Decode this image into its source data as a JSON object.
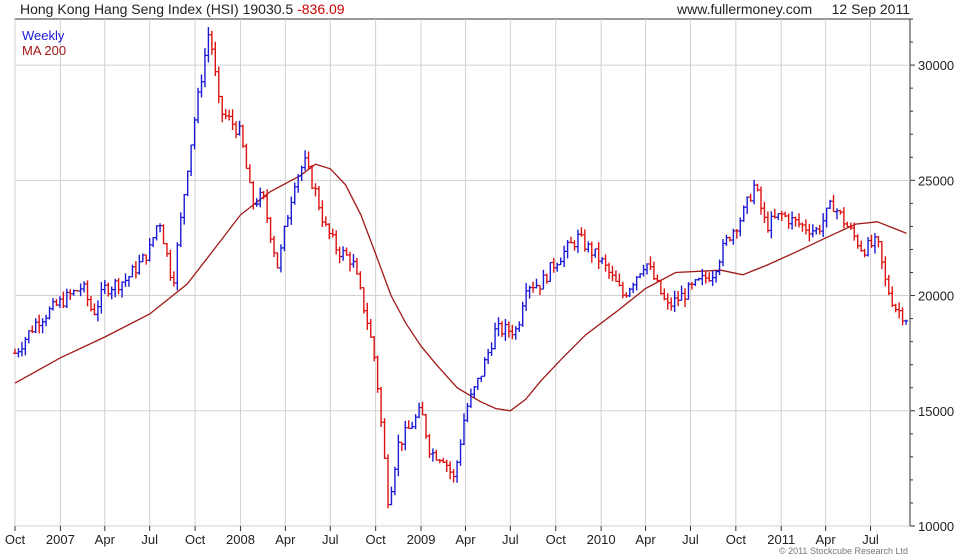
{
  "header": {
    "index_name": "Hong Kong Hang Seng Index (HSI)",
    "last_value": "19030.5",
    "change": "-836.09",
    "website": "www.fullermoney.com",
    "date": "12 Sep 2011"
  },
  "footer": {
    "copyright": "© 2011 Stockcube Research Ltd"
  },
  "colors": {
    "up": "#1a1ad6",
    "down": "#dd1111",
    "ma": "#a01818",
    "grid": "#d0d0d0",
    "axis": "#333333"
  },
  "chart_data": {
    "type": "line",
    "title": "Hong Kong Hang Seng Index (HSI)",
    "legend": [
      "Weekly",
      "MA 200"
    ],
    "legend_position": "top-left",
    "grid": true,
    "y_axis_side": "right",
    "ylim": [
      10000,
      32000
    ],
    "y_ticks": [
      10000,
      15000,
      20000,
      25000,
      30000
    ],
    "x_range": [
      "2006-10-01",
      "2011-09-19"
    ],
    "x_ticks": [
      {
        "label": "Oct",
        "date": "2006-10-01"
      },
      {
        "label": "2007",
        "date": "2007-01-01"
      },
      {
        "label": "Apr",
        "date": "2007-04-01"
      },
      {
        "label": "Jul",
        "date": "2007-07-01"
      },
      {
        "label": "Oct",
        "date": "2007-10-01"
      },
      {
        "label": "2008",
        "date": "2008-01-01"
      },
      {
        "label": "Apr",
        "date": "2008-04-01"
      },
      {
        "label": "Jul",
        "date": "2008-07-01"
      },
      {
        "label": "Oct",
        "date": "2008-10-01"
      },
      {
        "label": "2009",
        "date": "2009-01-01"
      },
      {
        "label": "Apr",
        "date": "2009-04-01"
      },
      {
        "label": "Jul",
        "date": "2009-07-01"
      },
      {
        "label": "Oct",
        "date": "2009-10-01"
      },
      {
        "label": "2010",
        "date": "2010-01-01"
      },
      {
        "label": "Apr",
        "date": "2010-04-01"
      },
      {
        "label": "Jul",
        "date": "2010-07-01"
      },
      {
        "label": "Oct",
        "date": "2010-10-01"
      },
      {
        "label": "2011",
        "date": "2011-01-01"
      },
      {
        "label": "Apr",
        "date": "2011-04-01"
      },
      {
        "label": "Jul",
        "date": "2011-07-01"
      }
    ],
    "series": [
      {
        "name": "Weekly",
        "points": [
          [
            "2006-10-01",
            17500
          ],
          [
            "2006-11-15",
            18900
          ],
          [
            "2007-01-01",
            19700
          ],
          [
            "2007-02-15",
            20400
          ],
          [
            "2007-03-08",
            19200
          ],
          [
            "2007-04-01",
            20300
          ],
          [
            "2007-05-15",
            20700
          ],
          [
            "2007-06-15",
            21500
          ],
          [
            "2007-07-01",
            22000
          ],
          [
            "2007-07-20",
            23400
          ],
          [
            "2007-08-17",
            20500
          ],
          [
            "2007-09-15",
            25500
          ],
          [
            "2007-10-01",
            27800
          ],
          [
            "2007-10-30",
            31600
          ],
          [
            "2007-11-20",
            28000
          ],
          [
            "2007-12-15",
            27500
          ],
          [
            "2008-01-01",
            27000
          ],
          [
            "2008-01-25",
            24000
          ],
          [
            "2008-02-15",
            24300
          ],
          [
            "2008-03-17",
            21200
          ],
          [
            "2008-04-01",
            23000
          ],
          [
            "2008-04-20",
            25000
          ],
          [
            "2008-05-10",
            25800
          ],
          [
            "2008-06-01",
            24500
          ],
          [
            "2008-06-20",
            23000
          ],
          [
            "2008-07-15",
            22000
          ],
          [
            "2008-08-15",
            21500
          ],
          [
            "2008-09-15",
            18800
          ],
          [
            "2008-10-01",
            17000
          ],
          [
            "2008-10-27",
            11000
          ],
          [
            "2008-11-15",
            13500
          ],
          [
            "2008-12-01",
            14000
          ],
          [
            "2009-01-01",
            15000
          ],
          [
            "2009-01-20",
            13200
          ],
          [
            "2009-02-15",
            13000
          ],
          [
            "2009-03-09",
            12000
          ],
          [
            "2009-04-01",
            15000
          ],
          [
            "2009-05-01",
            16500
          ],
          [
            "2009-06-01",
            18500
          ],
          [
            "2009-07-15",
            18500
          ],
          [
            "2009-08-01",
            20500
          ],
          [
            "2009-09-01",
            20500
          ],
          [
            "2009-10-01",
            21500
          ],
          [
            "2009-11-15",
            22500
          ],
          [
            "2010-01-01",
            21500
          ],
          [
            "2010-02-15",
            20000
          ],
          [
            "2010-04-01",
            21500
          ],
          [
            "2010-05-15",
            19500
          ],
          [
            "2010-06-15",
            20000
          ],
          [
            "2010-07-15",
            20500
          ],
          [
            "2010-08-15",
            21000
          ],
          [
            "2010-09-15",
            22500
          ],
          [
            "2010-10-15",
            23500
          ],
          [
            "2010-11-08",
            24800
          ],
          [
            "2010-12-01",
            23000
          ],
          [
            "2011-01-01",
            23500
          ],
          [
            "2011-02-15",
            23000
          ],
          [
            "2011-03-15",
            22800
          ],
          [
            "2011-04-15",
            24000
          ],
          [
            "2011-05-15",
            23000
          ],
          [
            "2011-06-15",
            22000
          ],
          [
            "2011-07-15",
            22300
          ],
          [
            "2011-08-01",
            20500
          ],
          [
            "2011-08-20",
            19500
          ],
          [
            "2011-09-12",
            19030
          ]
        ]
      },
      {
        "name": "MA 200",
        "points": [
          [
            "2006-10-01",
            16200
          ],
          [
            "2007-01-01",
            17300
          ],
          [
            "2007-04-01",
            18200
          ],
          [
            "2007-07-01",
            19200
          ],
          [
            "2007-09-15",
            20500
          ],
          [
            "2007-11-01",
            21800
          ],
          [
            "2008-01-01",
            23500
          ],
          [
            "2008-03-01",
            24500
          ],
          [
            "2008-05-01",
            25200
          ],
          [
            "2008-06-01",
            25700
          ],
          [
            "2008-07-01",
            25500
          ],
          [
            "2008-08-01",
            24800
          ],
          [
            "2008-09-01",
            23500
          ],
          [
            "2008-10-01",
            21800
          ],
          [
            "2008-11-01",
            20000
          ],
          [
            "2008-12-01",
            18800
          ],
          [
            "2009-01-01",
            17800
          ],
          [
            "2009-02-01",
            17000
          ],
          [
            "2009-03-15",
            16000
          ],
          [
            "2009-05-01",
            15400
          ],
          [
            "2009-06-01",
            15100
          ],
          [
            "2009-07-01",
            15000
          ],
          [
            "2009-08-01",
            15500
          ],
          [
            "2009-09-01",
            16300
          ],
          [
            "2009-10-15",
            17300
          ],
          [
            "2009-12-01",
            18300
          ],
          [
            "2010-02-01",
            19300
          ],
          [
            "2010-04-01",
            20300
          ],
          [
            "2010-06-01",
            21000
          ],
          [
            "2010-09-01",
            21100
          ],
          [
            "2010-10-15",
            20900
          ],
          [
            "2010-12-01",
            21300
          ],
          [
            "2011-02-01",
            21900
          ],
          [
            "2011-04-01",
            22500
          ],
          [
            "2011-06-01",
            23100
          ],
          [
            "2011-07-15",
            23200
          ],
          [
            "2011-09-12",
            22700
          ]
        ]
      }
    ]
  }
}
